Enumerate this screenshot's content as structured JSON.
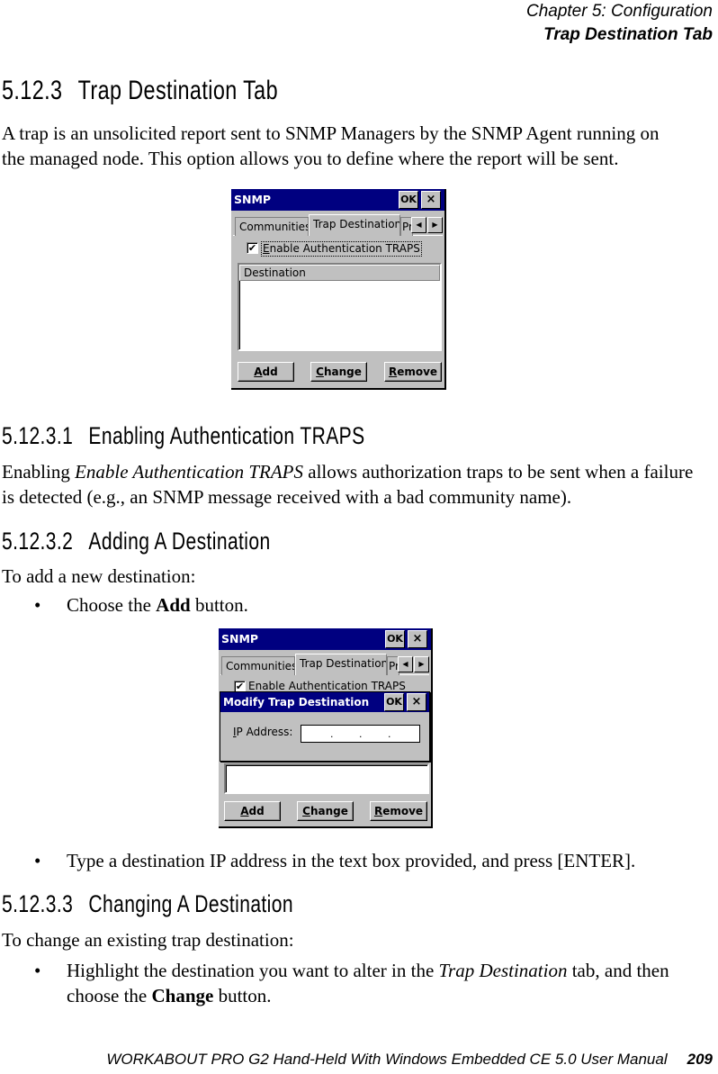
{
  "running_head": {
    "chapter": "Chapter  5:  Configuration",
    "section": "Trap Destination Tab"
  },
  "section": {
    "number": "5.12.3",
    "title": "Trap Destination Tab",
    "intro": "A trap is an unsolicited report sent to SNMP Managers by the SNMP Agent running on the managed node. This option allows you to define where the report will be sent."
  },
  "screenshot1": {
    "window_title": "SNMP",
    "ok_label": "OK",
    "close_label": "×",
    "tabs": [
      "Communities",
      "Trap Destination",
      "Pr"
    ],
    "active_tab": "Trap Destination",
    "scroll_left": "◀",
    "scroll_right": "▶",
    "checkbox_label": "Enable Authentication TRAPS",
    "checkbox_accel": "E",
    "checkbox_checked": true,
    "check_glyph": "✔",
    "list_column": "Destination",
    "buttons": [
      {
        "accel": "A",
        "rest": "dd"
      },
      {
        "accel": "C",
        "rest": "hange"
      },
      {
        "accel": "R",
        "rest": "emove"
      }
    ]
  },
  "subsection1": {
    "number": "5.12.3.1",
    "title": "Enabling Authentication TRAPS",
    "text_pre": "Enabling ",
    "text_em": "Enable Authentication TRAPS",
    "text_post": " allows authorization traps to be sent when a failure is detected (e.g., an SNMP message received with a bad community name)."
  },
  "subsection2": {
    "number": "5.12.3.2",
    "title": "Adding A Destination",
    "intro": "To add a new destination:",
    "bullet1_pre": "Choose the ",
    "bullet1_bold": "Add",
    "bullet1_post": " button.",
    "bullet2": "Type a destination IP address in the text box provided, and press [ENTER]."
  },
  "screenshot2": {
    "window_title": "SNMP",
    "ok_label": "OK",
    "close_label": "×",
    "tabs": [
      "Communities",
      "Trap Destination",
      "Pr"
    ],
    "scroll_left": "◀",
    "scroll_right": "▶",
    "checkbox_label": "Enable Authentication TRAPS",
    "check_glyph": "✔",
    "dialog_title": "Modify Trap Destination",
    "dialog_ok": "OK",
    "dialog_close": "×",
    "ip_label_accel": "I",
    "ip_label_rest": "P Address:",
    "ip_value": ".       .       .",
    "ip_dot": ".",
    "buttons": [
      {
        "accel": "A",
        "rest": "dd"
      },
      {
        "accel": "C",
        "rest": "hange"
      },
      {
        "accel": "R",
        "rest": "emove"
      }
    ]
  },
  "subsection3": {
    "number": "5.12.3.3",
    "title": "Changing A Destination",
    "intro": "To change an existing trap destination:",
    "bullet1_pre": "Highlight the destination you want to alter in the ",
    "bullet1_em": "Trap Destination",
    "bullet1_mid": " tab, and then choose the ",
    "bullet1_bold": "Change",
    "bullet1_post": " button."
  },
  "bullet_glyph": "•",
  "footer": {
    "manual": "WORKABOUT PRO G2 Hand-Held With Windows Embedded CE 5.0 User Manual",
    "page": "209"
  }
}
